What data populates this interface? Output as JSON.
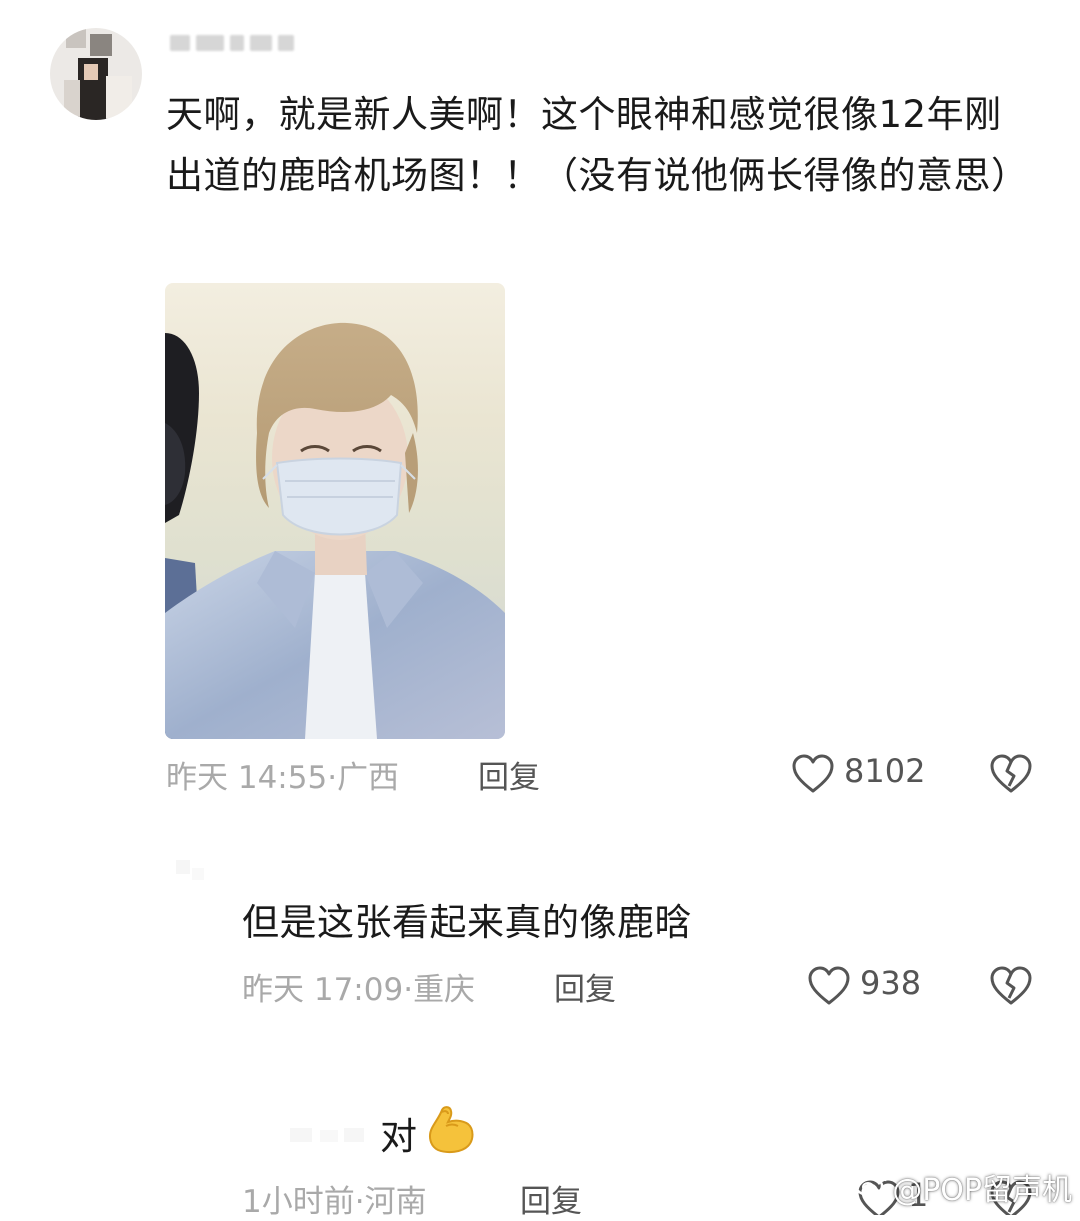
{
  "main_comment": {
    "text": "天啊，就是新人美啊！这个眼神和感觉很像12年刚出道的鹿晗机场图！！（没有说他俩长得像的意思）",
    "time": "昨天 14:55",
    "location": "广西",
    "reply_label": "回复",
    "like_count": "8102"
  },
  "reply_1": {
    "text": "但是这张看起来真的像鹿晗",
    "time": "昨天 17:09",
    "location": "重庆",
    "reply_label": "回复",
    "like_count": "938"
  },
  "reply_2": {
    "text": "对",
    "emoji": "💪",
    "time": "1小时前",
    "location": "河南",
    "reply_label": "回复",
    "like_count": "1"
  },
  "watermark": "@POP留声机",
  "icons": {
    "like": "heart-icon",
    "dislike": "broken-heart-icon"
  },
  "colors": {
    "meta_gray": "#a9a9a9",
    "text": "#1a1a1a",
    "icon_gray": "#555555"
  }
}
